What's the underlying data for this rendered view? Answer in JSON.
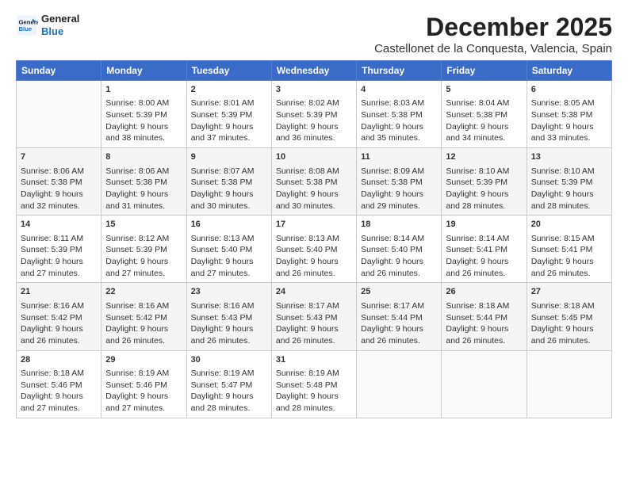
{
  "logo": {
    "line1": "General",
    "line2": "Blue"
  },
  "title": "December 2025",
  "subtitle": "Castellonet de la Conquesta, Valencia, Spain",
  "days_header": [
    "Sunday",
    "Monday",
    "Tuesday",
    "Wednesday",
    "Thursday",
    "Friday",
    "Saturday"
  ],
  "weeks": [
    [
      {
        "num": "",
        "data": ""
      },
      {
        "num": "1",
        "data": "Sunrise: 8:00 AM\nSunset: 5:39 PM\nDaylight: 9 hours\nand 38 minutes."
      },
      {
        "num": "2",
        "data": "Sunrise: 8:01 AM\nSunset: 5:39 PM\nDaylight: 9 hours\nand 37 minutes."
      },
      {
        "num": "3",
        "data": "Sunrise: 8:02 AM\nSunset: 5:39 PM\nDaylight: 9 hours\nand 36 minutes."
      },
      {
        "num": "4",
        "data": "Sunrise: 8:03 AM\nSunset: 5:38 PM\nDaylight: 9 hours\nand 35 minutes."
      },
      {
        "num": "5",
        "data": "Sunrise: 8:04 AM\nSunset: 5:38 PM\nDaylight: 9 hours\nand 34 minutes."
      },
      {
        "num": "6",
        "data": "Sunrise: 8:05 AM\nSunset: 5:38 PM\nDaylight: 9 hours\nand 33 minutes."
      }
    ],
    [
      {
        "num": "7",
        "data": "Sunrise: 8:06 AM\nSunset: 5:38 PM\nDaylight: 9 hours\nand 32 minutes."
      },
      {
        "num": "8",
        "data": "Sunrise: 8:06 AM\nSunset: 5:38 PM\nDaylight: 9 hours\nand 31 minutes."
      },
      {
        "num": "9",
        "data": "Sunrise: 8:07 AM\nSunset: 5:38 PM\nDaylight: 9 hours\nand 30 minutes."
      },
      {
        "num": "10",
        "data": "Sunrise: 8:08 AM\nSunset: 5:38 PM\nDaylight: 9 hours\nand 30 minutes."
      },
      {
        "num": "11",
        "data": "Sunrise: 8:09 AM\nSunset: 5:38 PM\nDaylight: 9 hours\nand 29 minutes."
      },
      {
        "num": "12",
        "data": "Sunrise: 8:10 AM\nSunset: 5:39 PM\nDaylight: 9 hours\nand 28 minutes."
      },
      {
        "num": "13",
        "data": "Sunrise: 8:10 AM\nSunset: 5:39 PM\nDaylight: 9 hours\nand 28 minutes."
      }
    ],
    [
      {
        "num": "14",
        "data": "Sunrise: 8:11 AM\nSunset: 5:39 PM\nDaylight: 9 hours\nand 27 minutes."
      },
      {
        "num": "15",
        "data": "Sunrise: 8:12 AM\nSunset: 5:39 PM\nDaylight: 9 hours\nand 27 minutes."
      },
      {
        "num": "16",
        "data": "Sunrise: 8:13 AM\nSunset: 5:40 PM\nDaylight: 9 hours\nand 27 minutes."
      },
      {
        "num": "17",
        "data": "Sunrise: 8:13 AM\nSunset: 5:40 PM\nDaylight: 9 hours\nand 26 minutes."
      },
      {
        "num": "18",
        "data": "Sunrise: 8:14 AM\nSunset: 5:40 PM\nDaylight: 9 hours\nand 26 minutes."
      },
      {
        "num": "19",
        "data": "Sunrise: 8:14 AM\nSunset: 5:41 PM\nDaylight: 9 hours\nand 26 minutes."
      },
      {
        "num": "20",
        "data": "Sunrise: 8:15 AM\nSunset: 5:41 PM\nDaylight: 9 hours\nand 26 minutes."
      }
    ],
    [
      {
        "num": "21",
        "data": "Sunrise: 8:16 AM\nSunset: 5:42 PM\nDaylight: 9 hours\nand 26 minutes."
      },
      {
        "num": "22",
        "data": "Sunrise: 8:16 AM\nSunset: 5:42 PM\nDaylight: 9 hours\nand 26 minutes."
      },
      {
        "num": "23",
        "data": "Sunrise: 8:16 AM\nSunset: 5:43 PM\nDaylight: 9 hours\nand 26 minutes."
      },
      {
        "num": "24",
        "data": "Sunrise: 8:17 AM\nSunset: 5:43 PM\nDaylight: 9 hours\nand 26 minutes."
      },
      {
        "num": "25",
        "data": "Sunrise: 8:17 AM\nSunset: 5:44 PM\nDaylight: 9 hours\nand 26 minutes."
      },
      {
        "num": "26",
        "data": "Sunrise: 8:18 AM\nSunset: 5:44 PM\nDaylight: 9 hours\nand 26 minutes."
      },
      {
        "num": "27",
        "data": "Sunrise: 8:18 AM\nSunset: 5:45 PM\nDaylight: 9 hours\nand 26 minutes."
      }
    ],
    [
      {
        "num": "28",
        "data": "Sunrise: 8:18 AM\nSunset: 5:46 PM\nDaylight: 9 hours\nand 27 minutes."
      },
      {
        "num": "29",
        "data": "Sunrise: 8:19 AM\nSunset: 5:46 PM\nDaylight: 9 hours\nand 27 minutes."
      },
      {
        "num": "30",
        "data": "Sunrise: 8:19 AM\nSunset: 5:47 PM\nDaylight: 9 hours\nand 28 minutes."
      },
      {
        "num": "31",
        "data": "Sunrise: 8:19 AM\nSunset: 5:48 PM\nDaylight: 9 hours\nand 28 minutes."
      },
      {
        "num": "",
        "data": ""
      },
      {
        "num": "",
        "data": ""
      },
      {
        "num": "",
        "data": ""
      }
    ]
  ]
}
